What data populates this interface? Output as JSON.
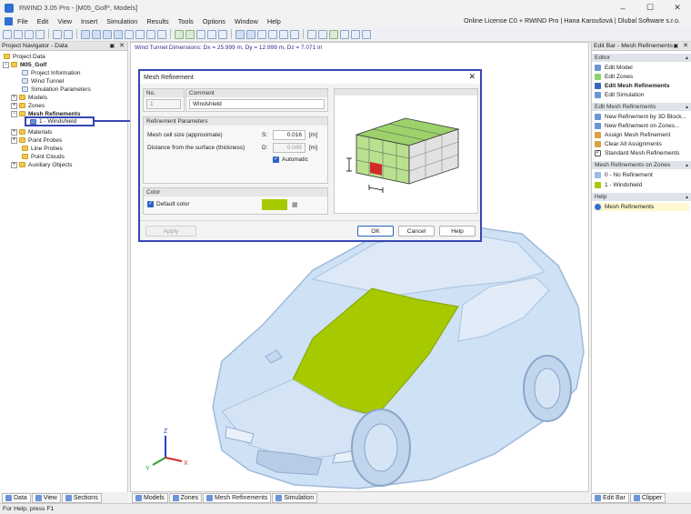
{
  "window": {
    "title": "RWIND 3.05 Pro - [M05_Golf*, Models]",
    "controls": [
      "minimize-icon",
      "maximize-icon",
      "close-icon"
    ]
  },
  "menu": {
    "items": [
      "File",
      "Edit",
      "View",
      "Insert",
      "Simulation",
      "Results",
      "Tools",
      "Options",
      "Window",
      "Help"
    ],
    "license": "Online License C0 + RWIND Pro | Hana Karoušová | Dlubal Software s.r.o."
  },
  "navigator": {
    "header": "Project Navigator - Data",
    "tree": [
      {
        "label": "Project Data",
        "icon": "folder-icon"
      },
      {
        "label": "M05_Golf",
        "icon": "folder-icon"
      },
      {
        "label": "Project Information",
        "icon": "file-icon"
      },
      {
        "label": "Wind Tunnel",
        "icon": "file-icon"
      },
      {
        "label": "Simulation Parameters",
        "icon": "file-icon"
      },
      {
        "label": "Models",
        "icon": "folder-icon"
      },
      {
        "label": "Zones",
        "icon": "folder-icon"
      },
      {
        "label": "Mesh Refinements",
        "icon": "folder-icon"
      },
      {
        "label": "1 - Windshield",
        "icon": "mesh-icon"
      },
      {
        "label": "Materials",
        "icon": "folder-icon"
      },
      {
        "label": "Point Probes",
        "icon": "folder-icon"
      },
      {
        "label": "Line Probes",
        "icon": "folder-icon"
      },
      {
        "label": "Point Clouds",
        "icon": "folder-icon"
      },
      {
        "label": "Auxiliary Objects",
        "icon": "folder-icon"
      }
    ],
    "tabs": [
      "Data",
      "View",
      "Sections"
    ]
  },
  "viewport": {
    "dimensions": "Wind Tunnel Dimensions: Dx = 25.999 m, Dy = 12.999 m, Dz = 7.071 m",
    "tabs": [
      "Models",
      "Zones",
      "Mesh Refinements",
      "Simulation"
    ],
    "axis": {
      "x": "X",
      "y": "Y",
      "z": "Z"
    }
  },
  "dialog": {
    "title": "Mesh Refinement",
    "no_label": "No.",
    "no_value": "1",
    "comment_label": "Comment",
    "comment_value": "Windshield",
    "params_title": "Refinement Parameters",
    "cell_size_label": "Mesh cell size (approximate)",
    "cell_size_symbol": "S:",
    "cell_size_value": "0.016",
    "cell_size_unit": "[m]",
    "distance_label": "Distance from the surface (thickness)",
    "distance_symbol": "D:",
    "distance_value": "0.045",
    "distance_unit": "[m]",
    "automatic_label": "Automatic",
    "automatic_checked": true,
    "color_title": "Color",
    "default_color_label": "Default color",
    "default_color_checked": true,
    "color_swatch": "#a6c900",
    "buttons": {
      "apply": "Apply",
      "ok": "OK",
      "cancel": "Cancel",
      "help": "Help"
    }
  },
  "editbar": {
    "header": "Edit Bar - Mesh Refinements",
    "sections": [
      {
        "title": "Editor",
        "items": [
          "Edit Model",
          "Edit Zones",
          "Edit Mesh Refinements",
          "Edit Simulation"
        ]
      },
      {
        "title": "Edit Mesh Refinements",
        "items": [
          "New Refinement by 3D Block...",
          "New Refinement on Zones...",
          "Assign Mesh Refinement",
          "Clear All Assignments",
          "Standard Mesh Refinements"
        ]
      },
      {
        "title": "Mesh Refinements on Zones",
        "items": [
          "0 - No Refinement",
          "1 - Windshield"
        ]
      },
      {
        "title": "Help",
        "items": [
          "Mesh Refinements"
        ]
      }
    ],
    "tabs": [
      "Edit Bar",
      "Clipper"
    ]
  },
  "status": {
    "text": "For Help, press F1"
  },
  "colors": {
    "accent": "#3646b5",
    "windshield": "#a6c900",
    "car": "#cfe1f4"
  }
}
